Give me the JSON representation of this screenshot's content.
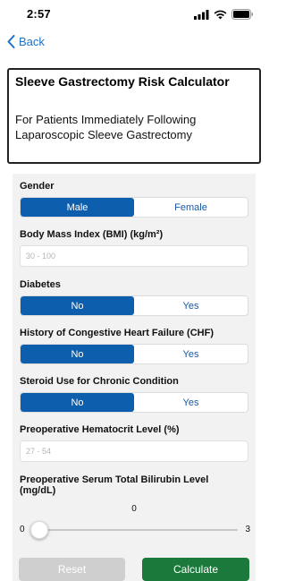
{
  "status": {
    "time": "2:57"
  },
  "nav": {
    "back_label": "Back"
  },
  "header": {
    "title": "Sleeve Gastrectomy Risk Calculator",
    "subtitle": "For Patients Immediately Following Laparoscopic Sleeve Gastrectomy"
  },
  "form": {
    "gender": {
      "label": "Gender",
      "options": [
        "Male",
        "Female"
      ],
      "selected": "Male"
    },
    "bmi": {
      "label": "Body Mass Index (BMI) (kg/m²)",
      "placeholder": "30 - 100",
      "value": ""
    },
    "diabetes": {
      "label": "Diabetes",
      "options": [
        "No",
        "Yes"
      ],
      "selected": "No"
    },
    "chf": {
      "label": "History of Congestive Heart Failure (CHF)",
      "options": [
        "No",
        "Yes"
      ],
      "selected": "No"
    },
    "steroid": {
      "label": "Steroid Use for Chronic Condition",
      "options": [
        "No",
        "Yes"
      ],
      "selected": "No"
    },
    "hematocrit": {
      "label": "Preoperative Hematocrit Level (%)",
      "placeholder": "27 - 54",
      "value": ""
    },
    "bilirubin": {
      "label_line1": "Preoperative Serum Total Bilirubin Level",
      "label_line2": "(mg/dL)",
      "value": "0",
      "min": "0",
      "max": "3",
      "fraction": 0
    }
  },
  "buttons": {
    "reset_label": "Reset",
    "calculate_label": "Calculate"
  },
  "colors": {
    "accent": "#0d5fae",
    "link": "#1a72c9",
    "calculate": "#1b7a3b",
    "reset": "#cfcfcf"
  }
}
